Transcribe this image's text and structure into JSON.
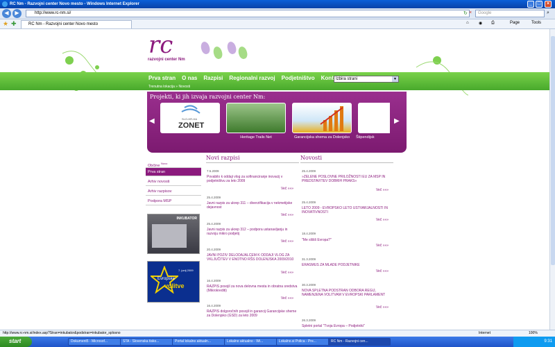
{
  "window": {
    "title": "RC Nm - Razvojni center Novo mesto - Windows Internet Explorer"
  },
  "address": {
    "url": "http://www.rc-nm.si/",
    "search_placeholder": "Google"
  },
  "tab": {
    "label": "RC Nm - Razvojni center Novo mesto"
  },
  "commands": {
    "page": "Page",
    "tools": "Tools"
  },
  "site": {
    "logo": "rc",
    "logo_sub": "razvojni center Nm",
    "nav": [
      "Prva stran",
      "O nas",
      "Razpisi",
      "Regionalni razvoj",
      "Podjetništvo",
      "Kontakt"
    ],
    "breadcrumb": "Trenutna lokacija » Novosti",
    "select_value": "Izbira strani",
    "projects_title": "Projekti, ki jih izvaja razvojni center Nm:",
    "projects": [
      {
        "caption": "",
        "thumb": "ZONET"
      },
      {
        "caption": "Heritage Trails Net",
        "thumb": ""
      },
      {
        "caption": "Garancijska shema za Dolenjsko",
        "thumb": ""
      },
      {
        "caption": "Štipendijsk",
        "thumb": ""
      }
    ],
    "zonet_top": "SLO-HR-HA",
    "left_menu": [
      "Občine",
      "Prva stran",
      "Arhiv novosti",
      "Arhiv razpisov",
      "Podpora MSP"
    ],
    "novo_badge": "Novo",
    "inkubator_label": "INKUBATOR",
    "evro_lines": [
      "Evropske",
      "volitve",
      "7. junij 2009"
    ],
    "col1_title": "Novi razpisi",
    "col2_title": "Novosti",
    "more": "Več »»»",
    "razpisi": [
      {
        "date": "7.5.2009",
        "text": "Povabilo k oddaji vlog za sofinanciranje inovacij v podjetništvu za leto 2009"
      },
      {
        "date": "25.4.2009",
        "text": "Javni razpis za ukrep 311 – diverzifikacija v nekmetijske dejavnost"
      },
      {
        "date": "25.4.2009",
        "text": "Javni razpis za ukrep 312 – podpora ustanavljanju in razvoju mikro podjetij"
      },
      {
        "date": "20.4.2009",
        "text": "JAVNI POZIV DELODAJALCEM K ODDAJI VLOG ZA VKLJUČITEV V ENOTNO RŠS DOLENJSKA 2009/2010"
      },
      {
        "date": "16.4.2009",
        "text": "RAZPIS posojil za nova delovna mesta in obratna sredstva (Mikrokrediti)"
      },
      {
        "date": "16.4.2009",
        "text": "RAZPIS dolgoročnih posojil in garancij Garancijske sheme za Dolenjsko (GSD) za leto 2009"
      }
    ],
    "novosti": [
      {
        "date": "25.4.2009",
        "text": "»ZELENE POSLOVNE PRILOŽNOSTI EU ZA MSP IN PREDSTAVITEV DOBRIH PRAKS«"
      },
      {
        "date": "25.4.2009",
        "text": "LETO 2009 - EVROPSKO LETO USTVARJALNOSTI IN INOVATIVNOSTI"
      },
      {
        "date": "18.4.2009",
        "text": "\"Me slišiš Evropa?\""
      },
      {
        "date": "31.3.2009",
        "text": "ERASMUS ZA MLADE PODJETNIKE"
      },
      {
        "date": "30.3.2009",
        "text": "NOVA SPLETNA PODSTRAN ODBORA REGIJ, NAMENJENA VOLITVAM V EVROPSKI PARLAMENT"
      },
      {
        "date": "26.3.2009",
        "text": "Spletni portal \"Tvoja Evropa – Podjetniki\""
      }
    ]
  },
  "status": {
    "url": "http://www.rc-nm.si/index.asp?Stran=inkubator&podstran=inkubator_splosno",
    "zone": "Internet",
    "zoom": "100%"
  },
  "taskbar": {
    "start": "start",
    "tasks": [
      "Dokument5 - Microsof...",
      "STA - Slovenska tisko...",
      "Portal lokalno aktualn...",
      "Lokalno aktualno - Wi...",
      "Lokalno.si Polica - Pre...",
      "RC Nm - Razvojni cen..."
    ],
    "clock": "9:31"
  },
  "colors": {
    "purple": "#8b1a7d",
    "green": "#5cbd34"
  }
}
